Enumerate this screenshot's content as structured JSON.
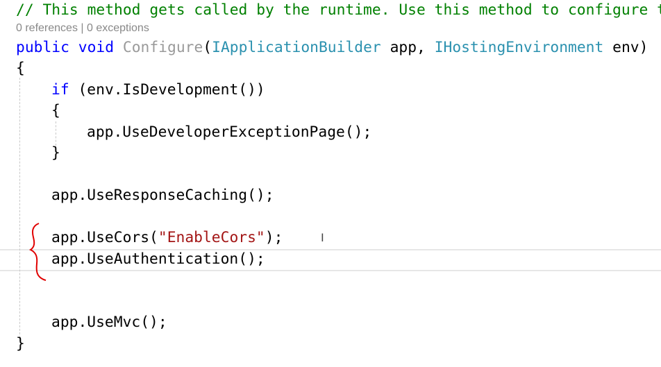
{
  "editor": {
    "comment": "// This method gets called by the runtime. Use this method to configure t",
    "codelens": "0 references | 0 exceptions",
    "signature": {
      "kw1": "public",
      "kw2": "void",
      "name": "Configure",
      "t1": "IApplicationBuilder",
      "p1": "app",
      "t2": "IHostingEnvironment",
      "p2": "env"
    },
    "open_brace": "{",
    "if_line": {
      "kw": "if",
      "rest": " (env.IsDevelopment())"
    },
    "if_open": "{",
    "dev_page": "app.UseDeveloperExceptionPage();",
    "if_close": "}",
    "response_caching": "app.UseResponseCaching();",
    "cors": {
      "pre": "app.UseCors(",
      "str": "\"EnableCors\"",
      "post": ");"
    },
    "authentication": "app.UseAuthentication();",
    "mvc": "app.UseMvc();",
    "close_brace": "}"
  },
  "annotation_color": "#e00000"
}
